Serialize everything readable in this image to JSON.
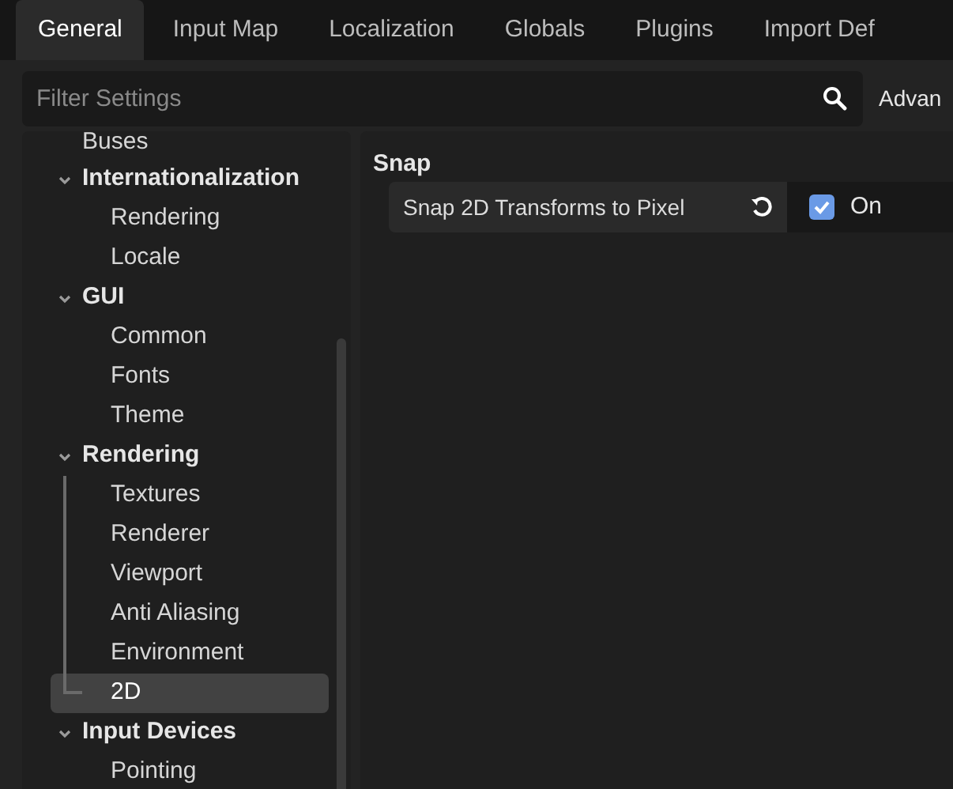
{
  "tabs": [
    {
      "label": "General",
      "selected": true
    },
    {
      "label": "Input Map",
      "selected": false
    },
    {
      "label": "Localization",
      "selected": false
    },
    {
      "label": "Globals",
      "selected": false
    },
    {
      "label": "Plugins",
      "selected": false
    },
    {
      "label": "Import Def",
      "selected": false
    }
  ],
  "filter": {
    "placeholder": "Filter Settings",
    "advanced_label": "Advan"
  },
  "tree": [
    {
      "label": "Buses",
      "kind": "leaf"
    },
    {
      "label": "Internationalization",
      "kind": "section",
      "expanded": true,
      "children": [
        {
          "label": "Rendering",
          "selected": false
        },
        {
          "label": "Locale",
          "selected": false
        }
      ]
    },
    {
      "label": "GUI",
      "kind": "section",
      "expanded": true,
      "children": [
        {
          "label": "Common",
          "selected": false
        },
        {
          "label": "Fonts",
          "selected": false
        },
        {
          "label": "Theme",
          "selected": false
        }
      ]
    },
    {
      "label": "Rendering",
      "kind": "section",
      "expanded": true,
      "children": [
        {
          "label": "Textures",
          "selected": false
        },
        {
          "label": "Renderer",
          "selected": false
        },
        {
          "label": "Viewport",
          "selected": false
        },
        {
          "label": "Anti Aliasing",
          "selected": false
        },
        {
          "label": "Environment",
          "selected": false
        },
        {
          "label": "2D",
          "selected": true
        }
      ]
    },
    {
      "label": "Input Devices",
      "kind": "section",
      "expanded": true,
      "children": [
        {
          "label": "Pointing",
          "selected": false
        }
      ]
    }
  ],
  "inspector": {
    "section": "Snap",
    "properties": [
      {
        "label": "Snap 2D Transforms to Pixel",
        "checked": true,
        "value": "On"
      }
    ]
  }
}
